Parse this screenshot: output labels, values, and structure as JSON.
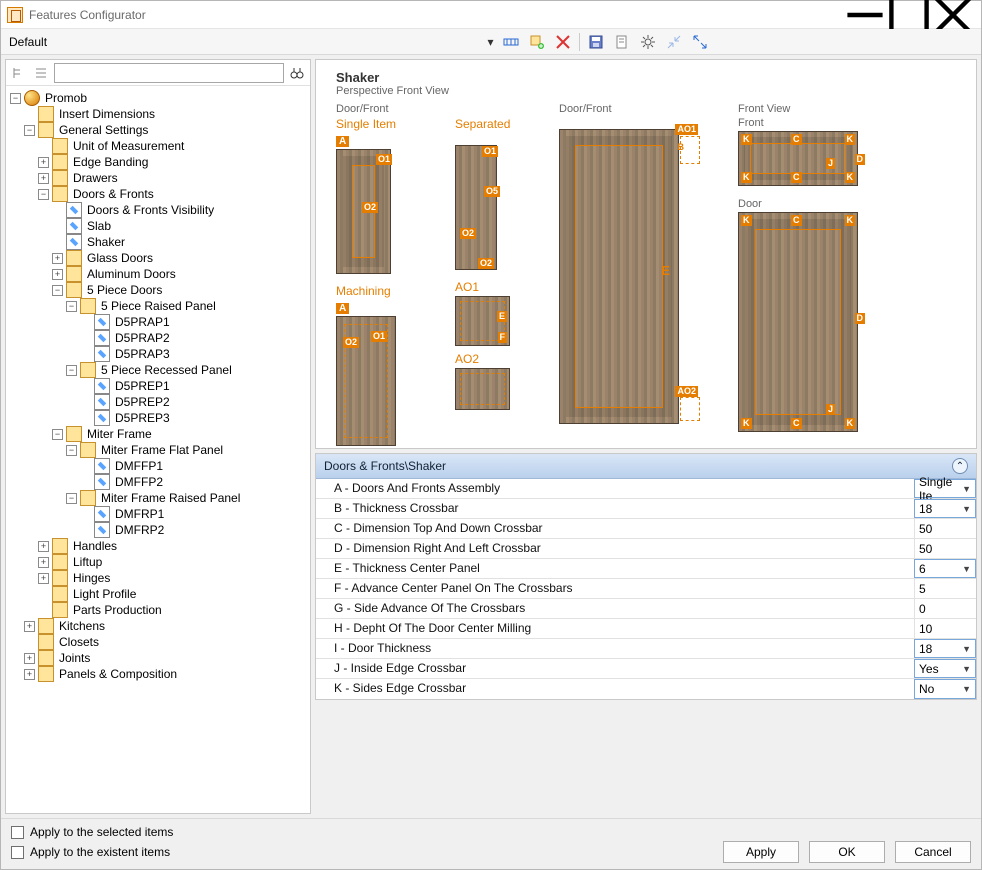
{
  "window": {
    "title": "Features Configurator"
  },
  "toolbar": {
    "left_label": "Default"
  },
  "search": {
    "value": ""
  },
  "tree": {
    "root": "Promob",
    "n1_insert_dimensions": "Insert Dimensions",
    "n1_general_settings": "General Settings",
    "gs_unit": "Unit of Measurement",
    "gs_edge": "Edge Banding",
    "gs_drawers": "Drawers",
    "gs_doors": "Doors & Fronts",
    "df_visibility": "Doors & Fronts Visibility",
    "df_slab": "Slab",
    "df_shaker": "Shaker",
    "df_glass": "Glass Doors",
    "df_alum": "Aluminum Doors",
    "df_5piece": "5 Piece Doors",
    "fp_raised": "5 Piece Raised Panel",
    "fp_r1": "D5PRAP1",
    "fp_r2": "D5PRAP2",
    "fp_r3": "D5PRAP3",
    "fp_recessed": "5 Piece Recessed Panel",
    "fp_e1": "D5PREP1",
    "fp_e2": "D5PREP2",
    "fp_e3": "D5PREP3",
    "df_miter": "Miter Frame",
    "mf_flat": "Miter Frame Flat Panel",
    "mf_f1": "DMFFP1",
    "mf_f2": "DMFFP2",
    "mf_raised": "Miter Frame Raised Panel",
    "mf_r1": "DMFRP1",
    "mf_r2": "DMFRP2",
    "gs_handles": "Handles",
    "gs_liftup": "Liftup",
    "gs_hinges": "Hinges",
    "gs_light": "Light Profile",
    "gs_parts": "Parts Production",
    "n1_kitchens": "Kitchens",
    "n1_closets": "Closets",
    "n1_joints": "Joints",
    "n1_panels": "Panels & Composition"
  },
  "preview": {
    "title": "Shaker",
    "subtitle": "Perspective Front View",
    "col1_header": "Door/Front",
    "col1_l1": "Single Item",
    "col1_l2": "Separated",
    "col1_l3": "Machining",
    "col2_header": "Door/Front",
    "col3_header": "Front View",
    "col3_l1": "Front",
    "col3_l2": "Door",
    "tags": {
      "A": "A",
      "B": "B",
      "C": "C",
      "D": "D",
      "E": "E",
      "F": "F",
      "J": "J",
      "K": "K",
      "AO1": "AO1",
      "AO2": "AO2",
      "O1": "O1",
      "O2": "O2",
      "O5": "O5"
    }
  },
  "props": {
    "header": "Doors & Fronts\\Shaker",
    "rows": [
      {
        "k": "A - Doors And Fronts Assembly",
        "v": "Single Ite",
        "dd": true
      },
      {
        "k": "B - Thickness Crossbar",
        "v": "18",
        "dd": true
      },
      {
        "k": "C - Dimension Top And Down Crossbar",
        "v": "50"
      },
      {
        "k": "D - Dimension Right And Left Crossbar",
        "v": "50"
      },
      {
        "k": "E - Thickness Center Panel",
        "v": "6",
        "dd": true
      },
      {
        "k": "F - Advance Center Panel On The Crossbars",
        "v": "5"
      },
      {
        "k": "G - Side Advance Of The Crossbars",
        "v": "0"
      },
      {
        "k": "H - Depht Of The Door Center Milling",
        "v": "10"
      },
      {
        "k": "I - Door Thickness",
        "v": "18",
        "dd": true
      },
      {
        "k": "J - Inside Edge Crossbar",
        "v": "Yes",
        "dd": true
      },
      {
        "k": "K - Sides Edge Crossbar",
        "v": "No",
        "dd": true
      }
    ]
  },
  "footer": {
    "chk1": "Apply to the selected items",
    "chk2": "Apply to the existent items",
    "apply": "Apply",
    "ok": "OK",
    "cancel": "Cancel"
  }
}
